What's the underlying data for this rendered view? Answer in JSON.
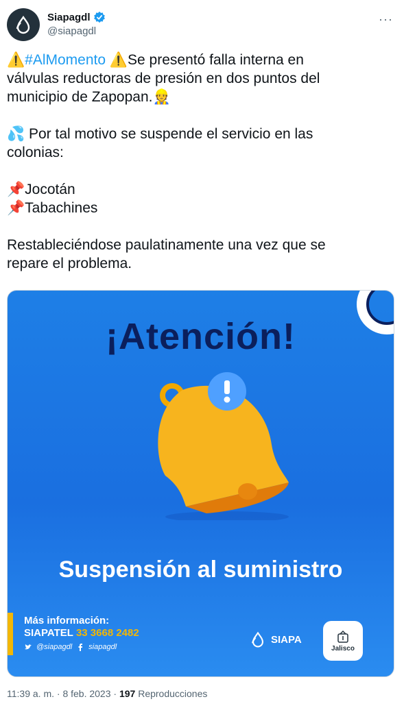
{
  "header": {
    "display_name": "Siapagdl",
    "handle": "@siapagdl",
    "more_label": "···"
  },
  "tweet": {
    "line1_a": "⚠️",
    "hashtag": "#AlMomento",
    "line1_b": "⚠️Se presentó falla interna en",
    "line2": "válvulas reductoras de presión en dos puntos del",
    "line3": "municipio de Zapopan.👷",
    "line4": "💦 Por tal motivo se suspende el servicio en las",
    "line5": "colonias:",
    "line6": "📌Jocotán",
    "line7": "📌Tabachines",
    "line8": "Restableciéndose paulatinamente una vez que se",
    "line9": "repare el problema."
  },
  "media": {
    "headline": "¡Atención!",
    "subheadline": "Suspensión al suministro",
    "info_label": "Más información:",
    "phone_label": "SIAPATEL",
    "phone_number": "33 3668 2482",
    "twitter_handle": "@siapagdl",
    "facebook_handle": "siapagdl",
    "brand": "SIAPA",
    "gov_logo_text": "Jalisco",
    "colors": {
      "background": "#1e7fe6",
      "headline": "#0b1f5c",
      "accent": "#f2b705"
    }
  },
  "footer": {
    "time": "11:39 a. m. · 8 feb. 2023 · ",
    "views_count": "197",
    "views_label": " Reproducciones"
  }
}
